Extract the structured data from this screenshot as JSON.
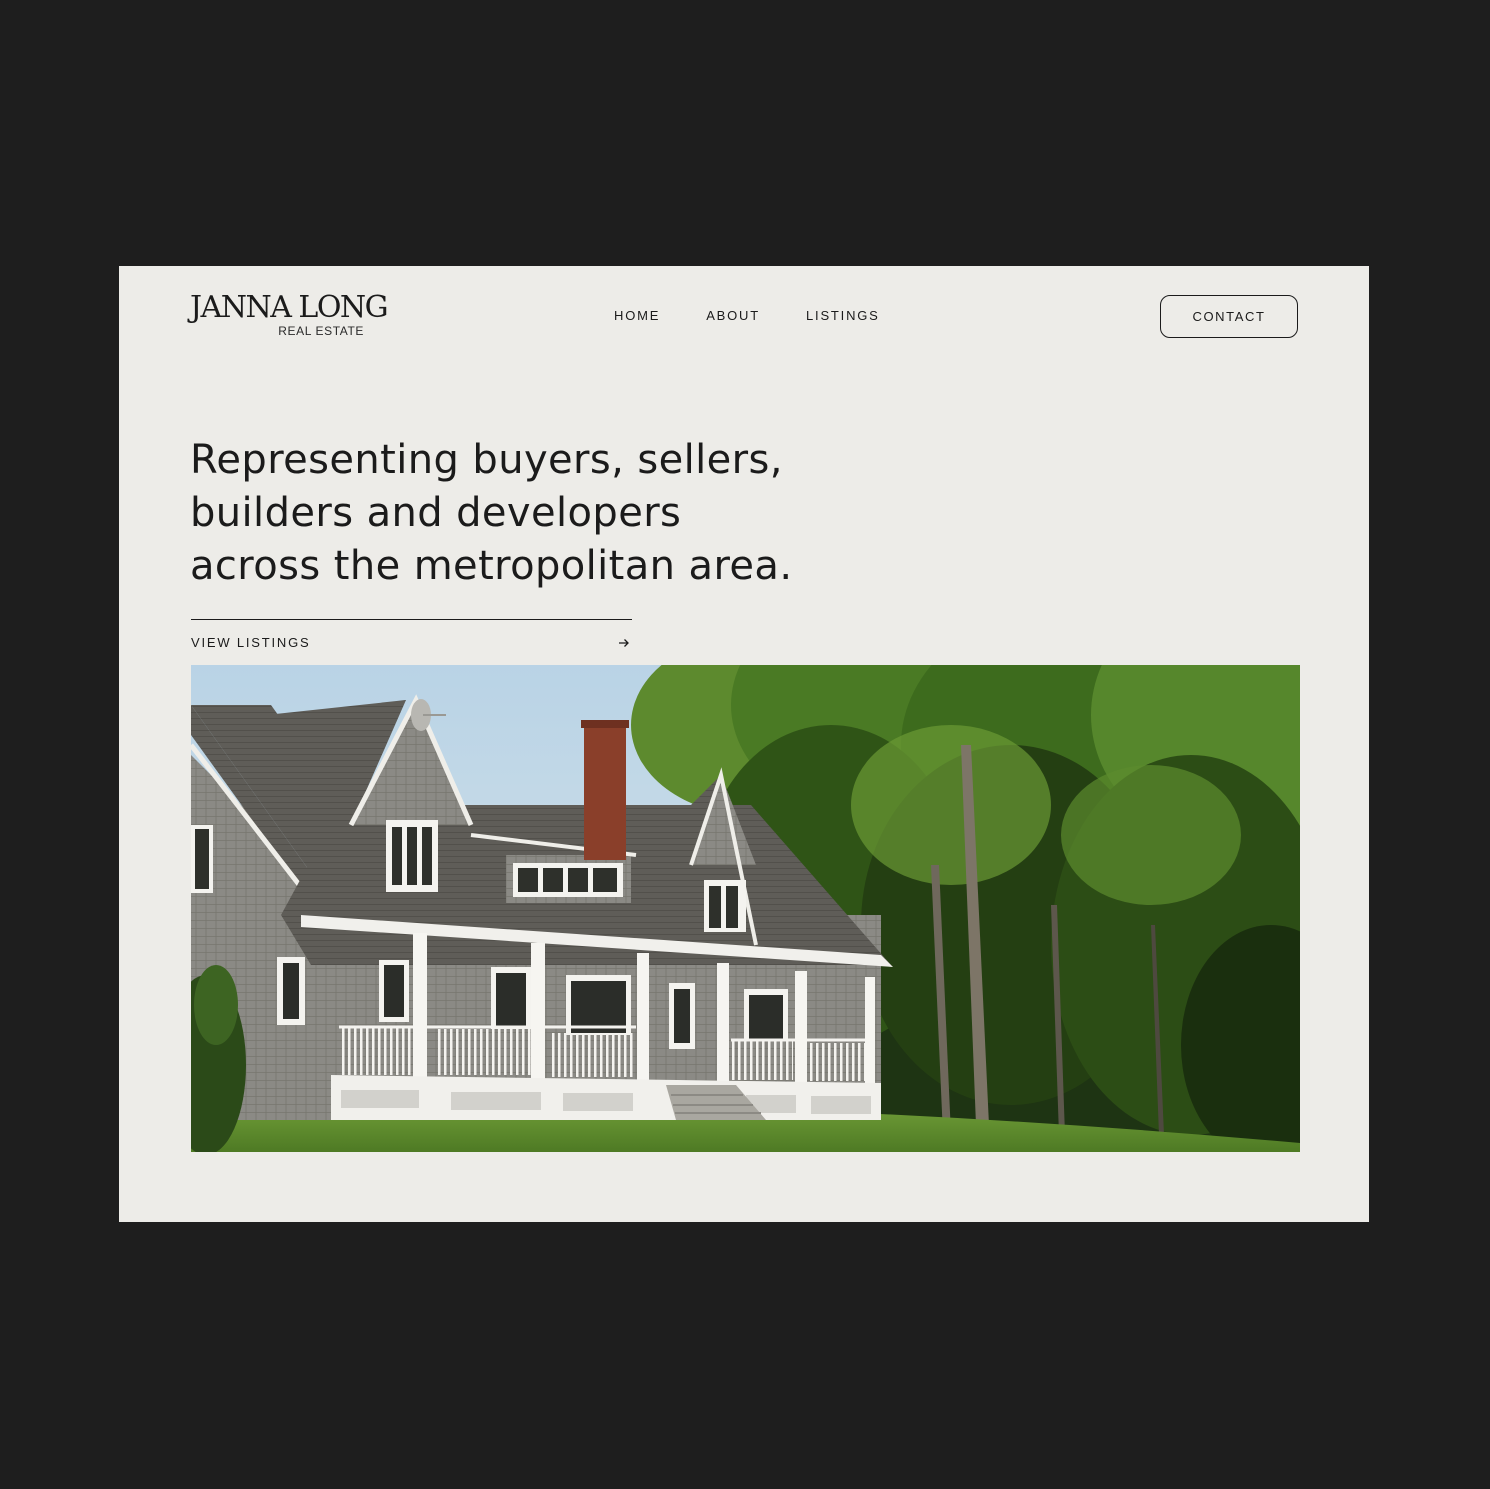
{
  "brand": {
    "logo_name": "JANNA LONG",
    "logo_sub": "REAL ESTATE"
  },
  "nav": {
    "items": [
      {
        "label": "HOME"
      },
      {
        "label": "ABOUT"
      },
      {
        "label": "LISTINGS"
      }
    ]
  },
  "header": {
    "contact_label": "CONTACT"
  },
  "hero": {
    "headline_lines": [
      "Representing buyers, sellers,",
      "builders and developers",
      "across the metropolitan area."
    ],
    "cta_label": "VIEW LISTINGS",
    "cta_icon": "arrow-right-icon",
    "image_alt": "Shingled house with white wraparound porch among trees"
  },
  "colors": {
    "frame": "#1e1e1e",
    "page": "#edece8",
    "text": "#1b1b1b"
  }
}
